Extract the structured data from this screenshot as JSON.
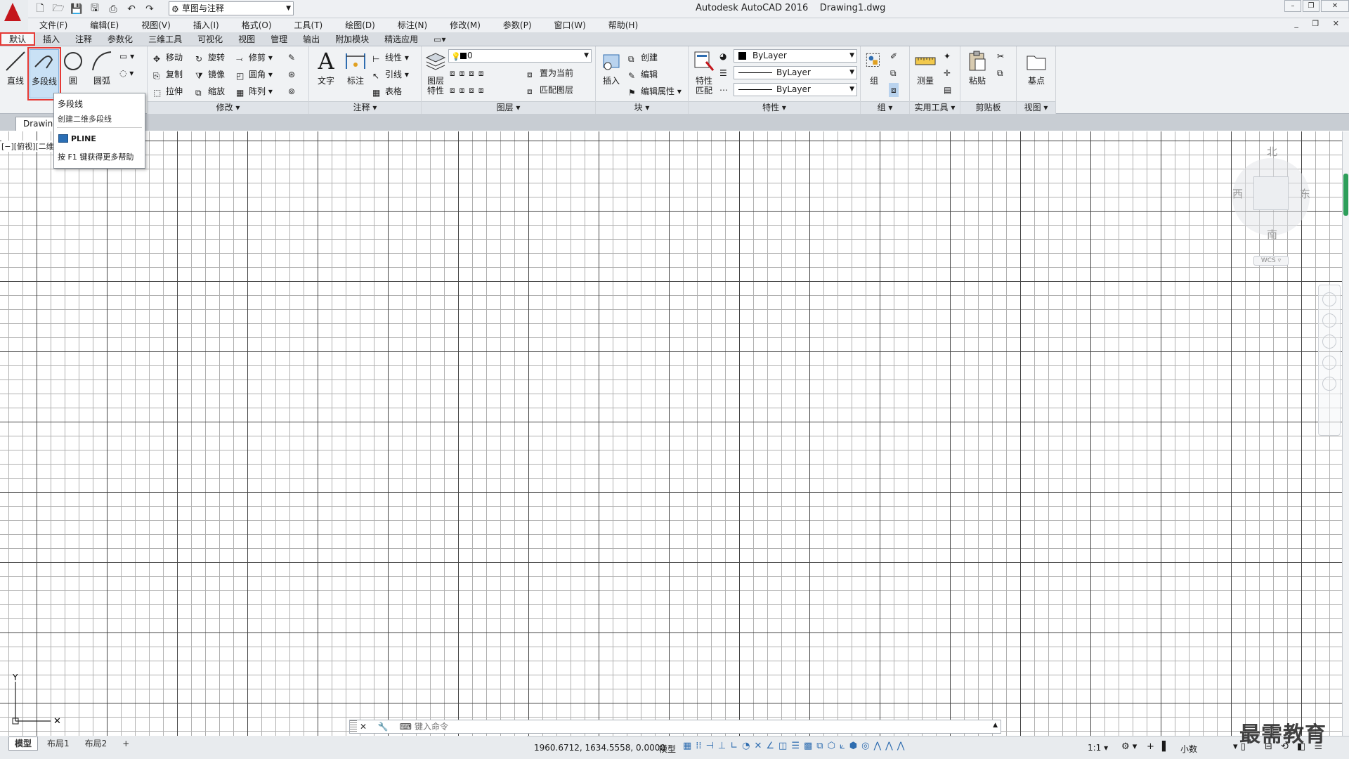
{
  "window": {
    "title": "Autodesk AutoCAD 2016    Drawing1.dwg",
    "workspace": "草图与注释",
    "controls": [
      "–",
      "❐",
      "✕"
    ],
    "doc_controls": "_ ❐ ✕"
  },
  "menubar": [
    "文件(F)",
    "编辑(E)",
    "视图(V)",
    "插入(I)",
    "格式(O)",
    "工具(T)",
    "绘图(D)",
    "标注(N)",
    "修改(M)",
    "参数(P)",
    "窗口(W)",
    "帮助(H)"
  ],
  "ribbon_tabs": [
    "默认",
    "插入",
    "注释",
    "参数化",
    "三维工具",
    "可视化",
    "视图",
    "管理",
    "输出",
    "附加模块",
    "精选应用",
    "▭▾"
  ],
  "ribbon": {
    "draw": {
      "line": "直线",
      "pline": "多段线",
      "circle": "圆",
      "arc": "圆弧"
    },
    "modify": {
      "title": "修改 ▾",
      "move": "移动",
      "rotate": "旋转",
      "trim": "修剪",
      "copy": "复制",
      "mirror": "镜像",
      "fillet": "圆角",
      "stretch": "拉伸",
      "scale": "缩放",
      "array": "阵列"
    },
    "annotation": {
      "title": "注释 ▾",
      "text": "文字",
      "dimension": "标注",
      "linear": "线性",
      "leader": "引线",
      "table": "表格"
    },
    "layers": {
      "title": "图层 ▾",
      "props": "图层\n特性",
      "props1": "图层",
      "props2": "特性",
      "current": "0",
      "make_current": "置为当前",
      "match": "匹配图层"
    },
    "block": {
      "title": "块 ▾",
      "insert": "插入",
      "create": "创建",
      "edit": "编辑",
      "edit_attr": "编辑属性"
    },
    "properties": {
      "title": "特性 ▾",
      "match1": "特性",
      "match2": "匹配",
      "color": "ByLayer",
      "linetype": "ByLayer",
      "lineweight": "ByLayer"
    },
    "groups": {
      "title": "组 ▾",
      "group": "组"
    },
    "utilities": {
      "title": "实用工具 ▾",
      "measure": "测量"
    },
    "clipboard": {
      "title": "剪贴板",
      "paste": "粘贴"
    },
    "view": {
      "title": "视图 ▾",
      "base": "基点"
    }
  },
  "file_tab": "Drawing",
  "viewport_label": "[−][俯视][二维",
  "tooltip": {
    "title": "多段线",
    "desc": "创建二维多段线",
    "command": "PLINE",
    "help": "按 F1 键获得更多帮助"
  },
  "viewcube": {
    "north": "北",
    "south": "南",
    "east": "东",
    "west": "西",
    "wcs": "WCS ▿"
  },
  "command_line": {
    "buttons": "✕ 🔧 ⌨",
    "placeholder": "键入命令"
  },
  "layout_tabs": [
    "模型",
    "布局1",
    "布局2",
    "+"
  ],
  "status": {
    "coords": "1960.6712, 1634.5558, 0.0000",
    "mode": "模型",
    "scale": "1:1 ▾",
    "units": "小数"
  },
  "watermark": "最需教育",
  "colors": {
    "accent_red": "#e53935",
    "logo_red": "#c4161c",
    "highlight_blue": "#c9e1f5"
  }
}
